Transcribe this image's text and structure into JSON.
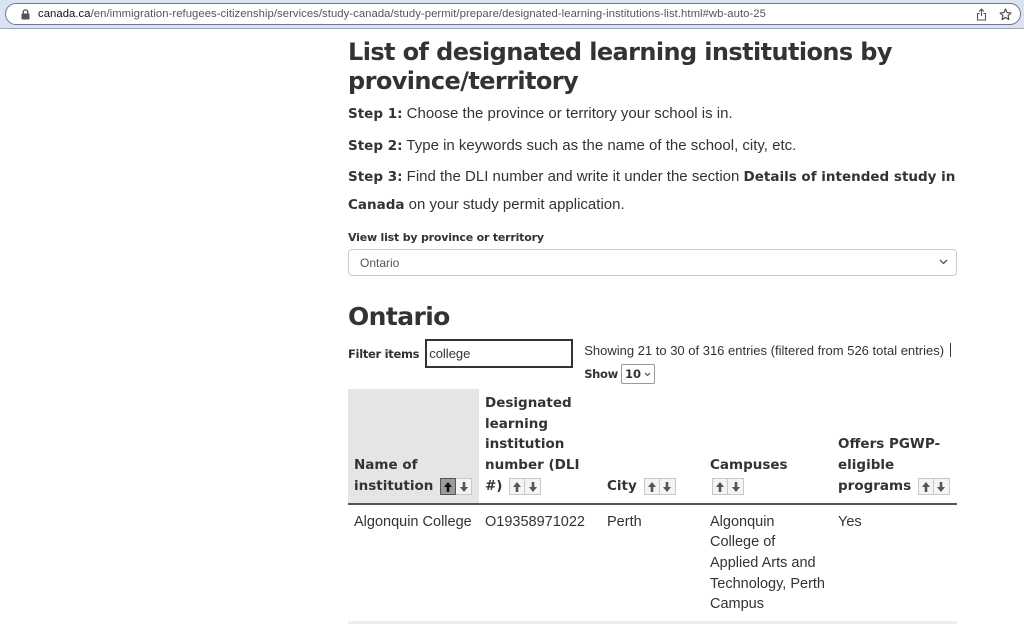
{
  "browser": {
    "url_host": "canada.ca",
    "url_path": "/en/immigration-refugees-citizenship/services/study-canada/study-permit/prepare/designated-learning-institutions-list.html#wb-auto-25",
    "icons": [
      "lock-icon",
      "share-icon",
      "bookmark-star-icon"
    ]
  },
  "page": {
    "title": "List of designated learning institutions by province/territory",
    "steps": [
      {
        "label": "Step 1:",
        "text": " Choose the province or territory your school is in."
      },
      {
        "label": "Step 2:",
        "text": " Type in keywords such as the name of the school, city, etc."
      },
      {
        "label": "Step 3:",
        "text_before": " Find the DLI number and write it under the section ",
        "emphasis": "Details of intended study in Canada",
        "text_after": " on your study permit application."
      }
    ],
    "province_select": {
      "label": "View list by province or territory",
      "selected": "Ontario"
    },
    "section_title": "Ontario"
  },
  "table_controls": {
    "filter_label": "Filter items",
    "filter_value": "college",
    "showing_text": "Showing 21 to 30 of 316 entries (filtered from 526 total entries)",
    "show_label": "Show",
    "show_value": "10"
  },
  "table": {
    "columns": [
      {
        "label": "Name of institution",
        "sorted": "ascending"
      },
      {
        "label": "Designated learning institution number (DLI #)",
        "sorted": "none"
      },
      {
        "label": "City",
        "sorted": "none"
      },
      {
        "label": "Campuses",
        "sorted": "none"
      },
      {
        "label": "Offers PGWP-eligible programs",
        "sorted": "none"
      }
    ],
    "rows": [
      {
        "name": "Algonquin College",
        "dli": "O19358971022",
        "city": "Perth",
        "campus": "Algonquin College of Applied Arts and Technology, Perth Campus",
        "pgwp": "Yes"
      }
    ]
  }
}
